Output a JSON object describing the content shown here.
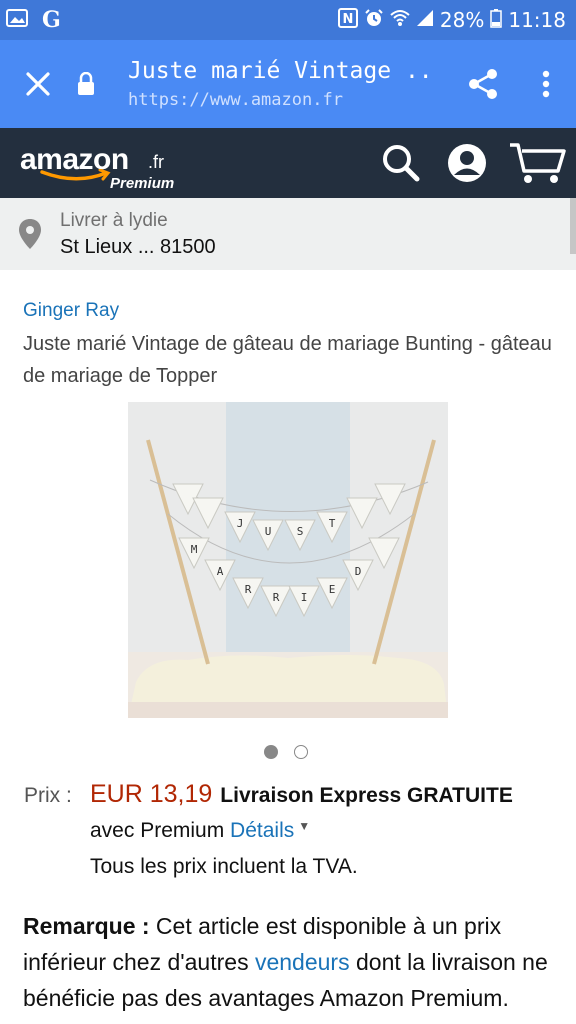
{
  "status_bar": {
    "app_glyph": "G",
    "battery": "28%",
    "time": "11:18"
  },
  "browser": {
    "page_title": "Juste marié Vintage ...",
    "url": "https://www.amazon.fr"
  },
  "amazon_header": {
    "logo_text": "amazon",
    "logo_domain": ".fr",
    "logo_premium": "Premium"
  },
  "delivery": {
    "deliver_to": "Livrer à lydie",
    "address": "St Lieux ... 81500"
  },
  "product": {
    "brand": "Ginger Ray",
    "title": "Juste marié Vintage de gâteau de mariage Bunting - gâteau de mariage de Topper",
    "image_pages": 2,
    "image_current_page": 1,
    "flags_top": [
      "J",
      "U",
      "S",
      "T"
    ],
    "flags_bottom": [
      "M",
      "A",
      "R",
      "R",
      "I",
      "E",
      "D"
    ]
  },
  "price": {
    "label": "Prix :",
    "value": "EUR 13,19",
    "delivery": "Livraison Express GRATUITE",
    "premium_text": "avec Premium",
    "details_link": "Détails",
    "tva": "Tous les prix incluent la TVA."
  },
  "note": {
    "label": "Remarque :",
    "text1": " Cet article est disponible à un prix inférieur chez d'autres ",
    "link": "vendeurs",
    "text2": " dont la livraison ne bénéficie pas des avantages Amazon Premium."
  },
  "colors": {
    "status_bar": "#3f78d8",
    "browser_bar": "#4a8af4",
    "amazon_header": "#232f3e",
    "smile": "#f90",
    "price": "#b12704",
    "link": "#1a73b8"
  }
}
